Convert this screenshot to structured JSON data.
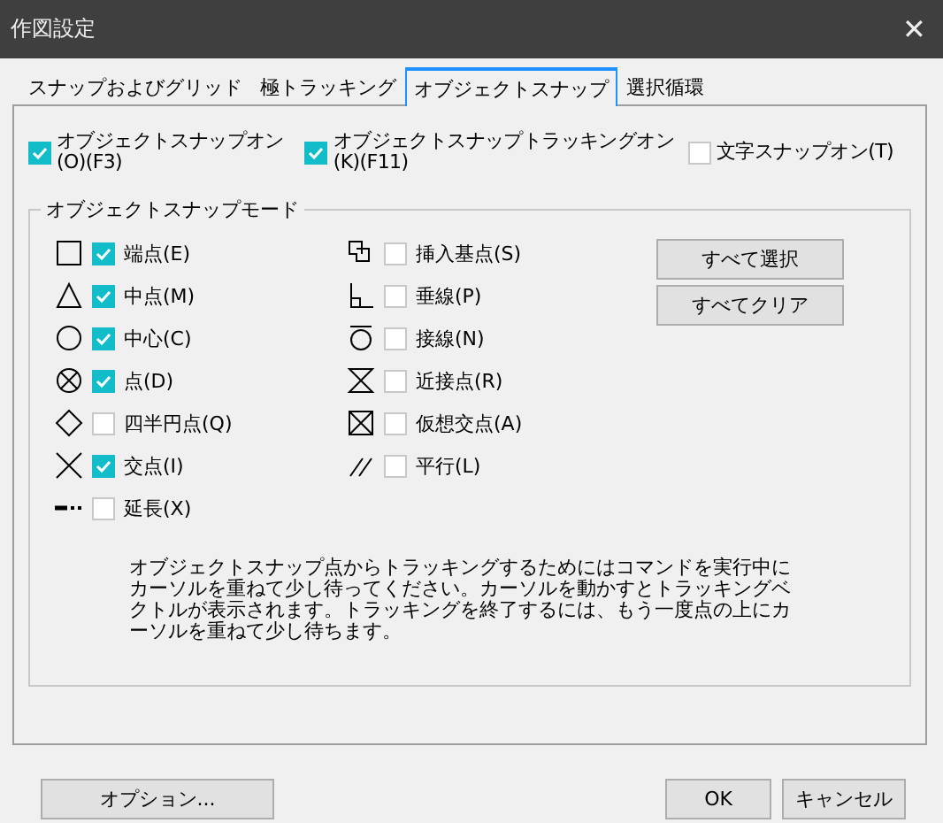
{
  "window": {
    "title": "作図設定",
    "close": "✕"
  },
  "tabs": [
    {
      "label": "スナップおよびグリッド",
      "selected": false
    },
    {
      "label": "極トラッキング",
      "selected": false
    },
    {
      "label": "オブジェクトスナップ",
      "selected": true
    },
    {
      "label": "選択循環",
      "selected": false
    }
  ],
  "top_options": [
    {
      "label": "オブジェクトスナップオン\n(O)(F3)",
      "checked": true
    },
    {
      "label": "オブジェクトスナップトラッキングオン\n(K)(F11)",
      "checked": true
    },
    {
      "label": "文字スナップオン(T)",
      "checked": false
    }
  ],
  "group": {
    "title": "オブジェクトスナップモード",
    "left_modes": [
      {
        "label": "端点(E)",
        "checked": true
      },
      {
        "label": "中点(M)",
        "checked": true
      },
      {
        "label": "中心(C)",
        "checked": true
      },
      {
        "label": "点(D)",
        "checked": true
      },
      {
        "label": "四半円点(Q)",
        "checked": false
      },
      {
        "label": "交点(I)",
        "checked": true
      },
      {
        "label": "延長(X)",
        "checked": false
      }
    ],
    "right_modes": [
      {
        "label": "挿入基点(S)",
        "checked": false
      },
      {
        "label": "垂線(P)",
        "checked": false
      },
      {
        "label": "接線(N)",
        "checked": false
      },
      {
        "label": "近接点(R)",
        "checked": false
      },
      {
        "label": "仮想交点(A)",
        "checked": false
      },
      {
        "label": "平行(L)",
        "checked": false
      }
    ],
    "buttons": [
      "すべて選択",
      "すべてクリア"
    ],
    "description": "オブジェクトスナップ点からトラッキングするためにはコマンドを実行中にカーソルを重ねて少し待ってください。カーソルを動かすとトラッキングベクトルが表示されます。トラッキングを終了するには、もう一度点の上にカーソルを重ねて少し待ちます。"
  },
  "footer": {
    "options_button": "オプション...",
    "ok_button": "OK",
    "cancel_button": "キャンセル"
  }
}
